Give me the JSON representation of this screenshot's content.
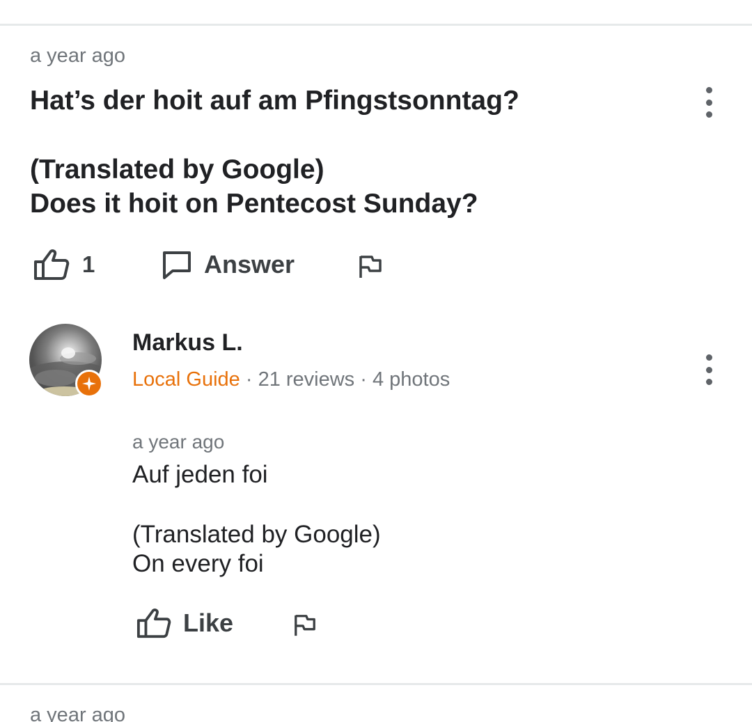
{
  "question": {
    "time": "a year ago",
    "text": "Hat’s der hoit auf am Pfingstsonntag?",
    "translated_label": "(Translated by Google)",
    "translated_text": "Does it hoit on Pentecost Sunday?",
    "like_count": "1",
    "answer_label": "Answer"
  },
  "answer": {
    "author": "Markus L.",
    "guide_label": "Local Guide",
    "separator": " · ",
    "reviews": "21 reviews",
    "photos": "4 photos",
    "time": "a year ago",
    "text": "Auf jeden foi",
    "translated_label": "(Translated by Google)",
    "translated_text": "On every foi",
    "like_label": "Like"
  },
  "next_item": {
    "time": "a year ago"
  },
  "colors": {
    "accent_orange": "#e8710a",
    "icon_gray": "#5f6368",
    "divider": "#e6e9ea"
  },
  "icons": [
    "thumb-up-icon",
    "comment-icon",
    "flag-icon",
    "more-vert-icon",
    "local-guide-star-icon"
  ]
}
